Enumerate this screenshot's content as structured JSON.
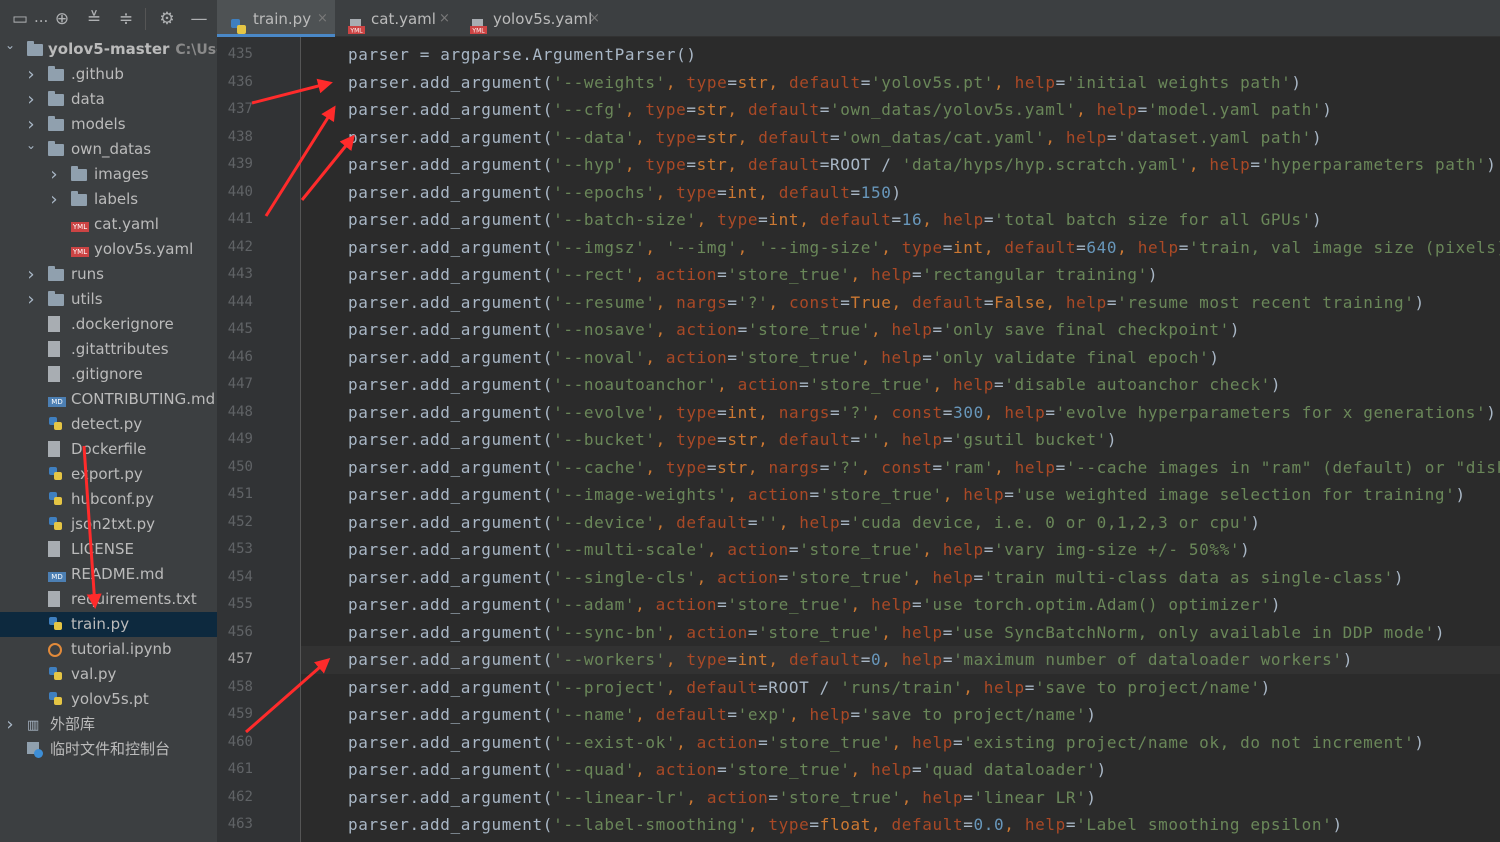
{
  "toolbar": {
    "dots": "..."
  },
  "tabs": [
    {
      "label": "train.py",
      "icon": "python-file-icon",
      "active": true
    },
    {
      "label": "cat.yaml",
      "icon": "yaml-file-icon",
      "active": false
    },
    {
      "label": "yolov5s.yaml",
      "icon": "yaml-file-icon",
      "active": false
    }
  ],
  "tab_close": "×",
  "tree": {
    "root": {
      "label": "yolov5-master",
      "path": "C:\\User"
    },
    "items": [
      {
        "label": ".github",
        "type": "folder",
        "depth": 1,
        "arrow": "right"
      },
      {
        "label": "data",
        "type": "folder",
        "depth": 1,
        "arrow": "right"
      },
      {
        "label": "models",
        "type": "folder",
        "depth": 1,
        "arrow": "right"
      },
      {
        "label": "own_datas",
        "type": "folder",
        "depth": 1,
        "arrow": "down"
      },
      {
        "label": "images",
        "type": "folder",
        "depth": 2,
        "arrow": "right"
      },
      {
        "label": "labels",
        "type": "folder",
        "depth": 2,
        "arrow": "right"
      },
      {
        "label": "cat.yaml",
        "type": "yaml",
        "depth": 2
      },
      {
        "label": "yolov5s.yaml",
        "type": "yaml",
        "depth": 2
      },
      {
        "label": "runs",
        "type": "folder",
        "depth": 1,
        "arrow": "right"
      },
      {
        "label": "utils",
        "type": "folder",
        "depth": 1,
        "arrow": "right"
      },
      {
        "label": ".dockerignore",
        "type": "file",
        "depth": 1
      },
      {
        "label": ".gitattributes",
        "type": "file",
        "depth": 1
      },
      {
        "label": ".gitignore",
        "type": "file",
        "depth": 1
      },
      {
        "label": "CONTRIBUTING.md",
        "type": "md",
        "depth": 1
      },
      {
        "label": "detect.py",
        "type": "py",
        "depth": 1
      },
      {
        "label": "Dockerfile",
        "type": "file",
        "depth": 1
      },
      {
        "label": "export.py",
        "type": "py",
        "depth": 1
      },
      {
        "label": "hubconf.py",
        "type": "py",
        "depth": 1
      },
      {
        "label": "json2txt.py",
        "type": "py",
        "depth": 1
      },
      {
        "label": "LICENSE",
        "type": "file",
        "depth": 1
      },
      {
        "label": "README.md",
        "type": "md",
        "depth": 1
      },
      {
        "label": "requirements.txt",
        "type": "txt",
        "depth": 1
      },
      {
        "label": "train.py",
        "type": "py",
        "depth": 1,
        "selected": true
      },
      {
        "label": "tutorial.ipynb",
        "type": "ipynb",
        "depth": 1
      },
      {
        "label": "val.py",
        "type": "py",
        "depth": 1
      },
      {
        "label": "yolov5s.pt",
        "type": "pt",
        "depth": 1
      },
      {
        "label": "外部库",
        "type": "lib",
        "depth": 0,
        "arrow": "right"
      },
      {
        "label": "临时文件和控制台",
        "type": "scratch",
        "depth": 0
      }
    ]
  },
  "editor": {
    "current_line": 457,
    "lines": [
      {
        "n": 435,
        "code": "parser = argparse.ArgumentParser()"
      },
      {
        "n": 436,
        "code": "parser.add_argument('--weights', type=str, default='yolov5s.pt', help='initial weights path')"
      },
      {
        "n": 437,
        "code": "parser.add_argument('--cfg', type=str, default='own_datas/yolov5s.yaml', help='model.yaml path')"
      },
      {
        "n": 438,
        "code": "parser.add_argument('--data', type=str, default='own_datas/cat.yaml', help='dataset.yaml path')"
      },
      {
        "n": 439,
        "code": "parser.add_argument('--hyp', type=str, default=ROOT / 'data/hyps/hyp.scratch.yaml', help='hyperparameters path')"
      },
      {
        "n": 440,
        "code": "parser.add_argument('--epochs', type=int, default=150)"
      },
      {
        "n": 441,
        "code": "parser.add_argument('--batch-size', type=int, default=16, help='total batch size for all GPUs')"
      },
      {
        "n": 442,
        "code": "parser.add_argument('--imgsz', '--img', '--img-size', type=int, default=640, help='train, val image size (pixels)')"
      },
      {
        "n": 443,
        "code": "parser.add_argument('--rect', action='store_true', help='rectangular training')"
      },
      {
        "n": 444,
        "code": "parser.add_argument('--resume', nargs='?', const=True, default=False, help='resume most recent training')"
      },
      {
        "n": 445,
        "code": "parser.add_argument('--nosave', action='store_true', help='only save final checkpoint')"
      },
      {
        "n": 446,
        "code": "parser.add_argument('--noval', action='store_true', help='only validate final epoch')"
      },
      {
        "n": 447,
        "code": "parser.add_argument('--noautoanchor', action='store_true', help='disable autoanchor check')"
      },
      {
        "n": 448,
        "code": "parser.add_argument('--evolve', type=int, nargs='?', const=300, help='evolve hyperparameters for x generations')"
      },
      {
        "n": 449,
        "code": "parser.add_argument('--bucket', type=str, default='', help='gsutil bucket')"
      },
      {
        "n": 450,
        "code": "parser.add_argument('--cache', type=str, nargs='?', const='ram', help='--cache images in \"ram\" (default) or \"disk\"')"
      },
      {
        "n": 451,
        "code": "parser.add_argument('--image-weights', action='store_true', help='use weighted image selection for training')"
      },
      {
        "n": 452,
        "code": "parser.add_argument('--device', default='', help='cuda device, i.e. 0 or 0,1,2,3 or cpu')"
      },
      {
        "n": 453,
        "code": "parser.add_argument('--multi-scale', action='store_true', help='vary img-size +/- 50%%')"
      },
      {
        "n": 454,
        "code": "parser.add_argument('--single-cls', action='store_true', help='train multi-class data as single-class')"
      },
      {
        "n": 455,
        "code": "parser.add_argument('--adam', action='store_true', help='use torch.optim.Adam() optimizer')"
      },
      {
        "n": 456,
        "code": "parser.add_argument('--sync-bn', action='store_true', help='use SyncBatchNorm, only available in DDP mode')"
      },
      {
        "n": 457,
        "code": "parser.add_argument('--workers', type=int, default=0, help='maximum number of dataloader workers')"
      },
      {
        "n": 458,
        "code": "parser.add_argument('--project', default=ROOT / 'runs/train', help='save to project/name')"
      },
      {
        "n": 459,
        "code": "parser.add_argument('--name', default='exp', help='save to project/name')"
      },
      {
        "n": 460,
        "code": "parser.add_argument('--exist-ok', action='store_true', help='existing project/name ok, do not increment')"
      },
      {
        "n": 461,
        "code": "parser.add_argument('--quad', action='store_true', help='quad dataloader')"
      },
      {
        "n": 462,
        "code": "parser.add_argument('--linear-lr', action='store_true', help='linear LR')"
      },
      {
        "n": 463,
        "code": "parser.add_argument('--label-smoothing', type=float, default=0.0, help='Label smoothing epsilon')"
      }
    ]
  },
  "colors": {
    "string": "#6a8759",
    "keyword_arg": "#aa4926",
    "number": "#6897bb",
    "builtin": "#cc7832",
    "annotation_arrow": "#ff2b2b",
    "selection": "#0d293e"
  }
}
